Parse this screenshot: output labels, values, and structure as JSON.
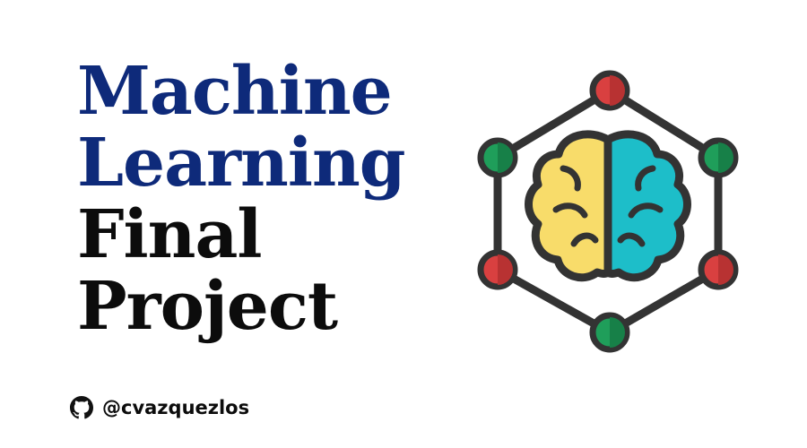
{
  "title": {
    "line1": "Machine",
    "line2": "Learning",
    "line3": "Final",
    "line4": "Project"
  },
  "handle": {
    "icon": "github-icon",
    "text": "@cvazquezlos"
  },
  "graphic": {
    "icon": "neural-brain-network-icon",
    "colors": {
      "accent_title": "#0e2a7a",
      "brain_left": "#f8dc6a",
      "brain_right": "#1dbec9",
      "node_red": "#d94040",
      "node_green": "#1f9e5a",
      "outline": "#333333"
    }
  }
}
